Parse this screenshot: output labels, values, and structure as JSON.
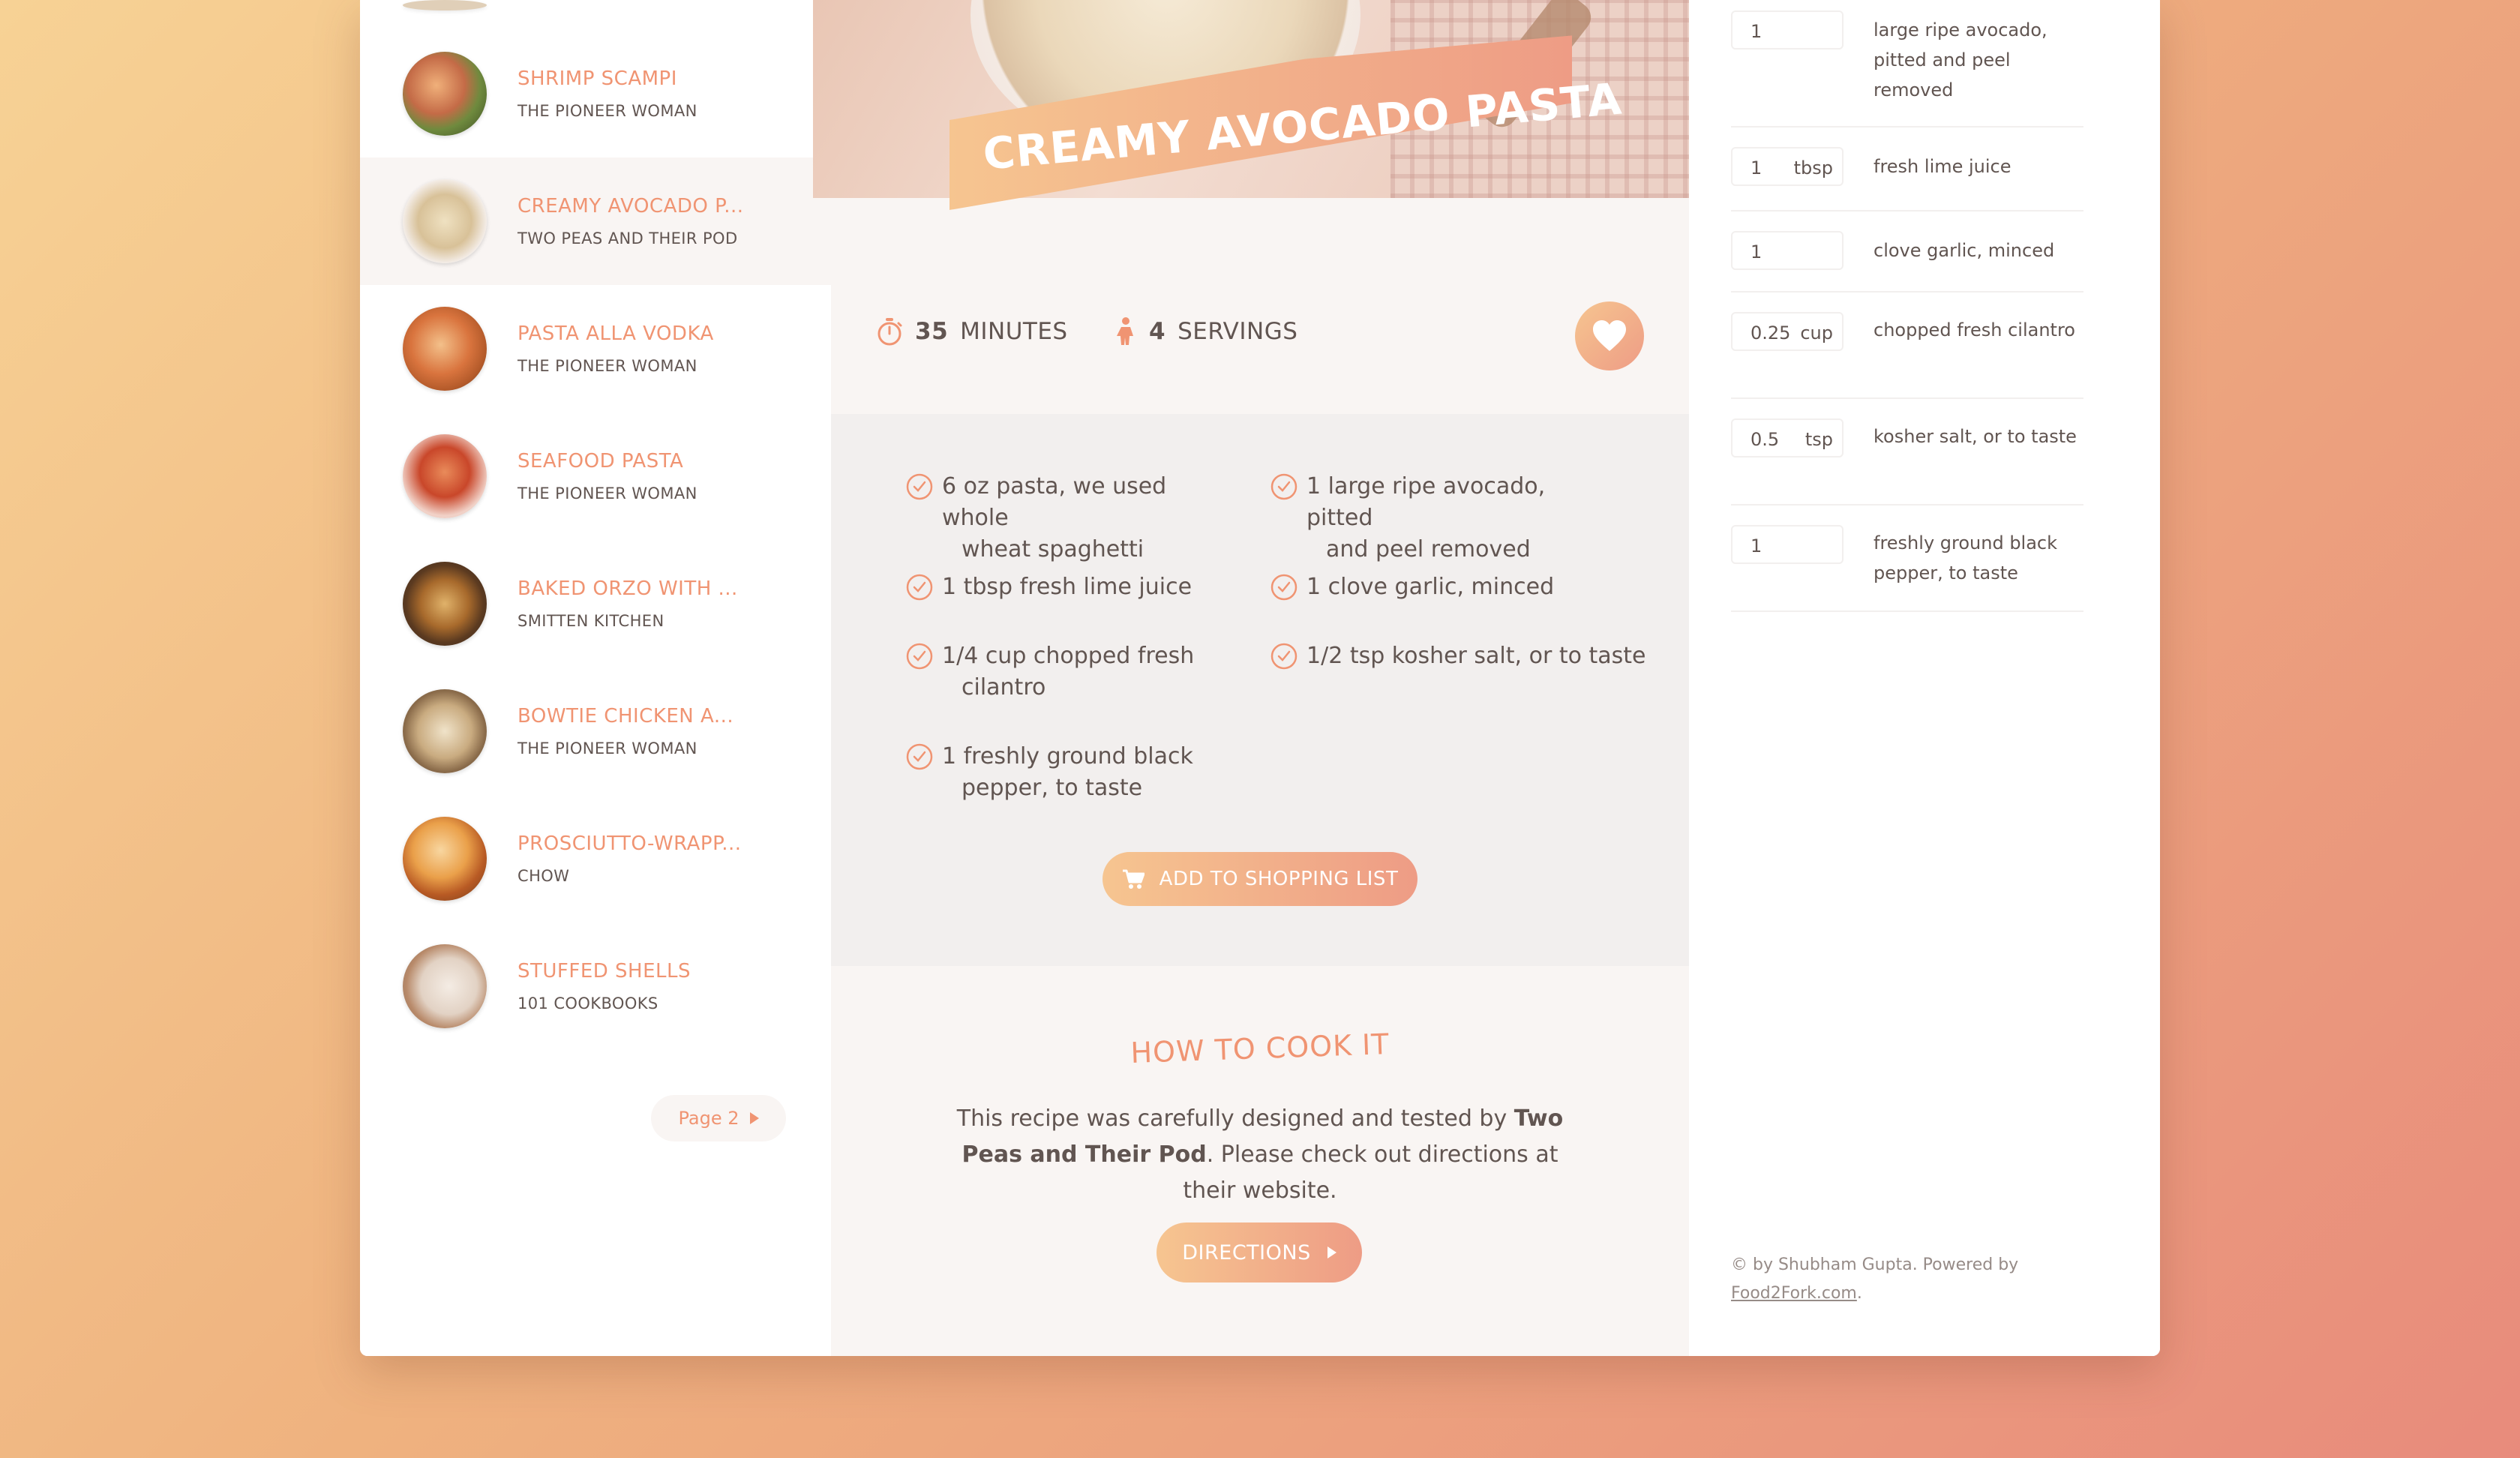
{
  "results": [
    {
      "title": "SHRIMP SCAMPI",
      "publisher": "THE PIONEER WOMAN",
      "active": false
    },
    {
      "title": "CREAMY AVOCADO P...",
      "publisher": "TWO PEAS AND THEIR POD",
      "active": true
    },
    {
      "title": "PASTA ALLA VODKA",
      "publisher": "THE PIONEER WOMAN",
      "active": false
    },
    {
      "title": "SEAFOOD PASTA",
      "publisher": "THE PIONEER WOMAN",
      "active": false
    },
    {
      "title": "BAKED ORZO WITH ...",
      "publisher": "SMITTEN KITCHEN",
      "active": false
    },
    {
      "title": "BOWTIE CHICKEN A...",
      "publisher": "THE PIONEER WOMAN",
      "active": false
    },
    {
      "title": "PROSCIUTTO-WRAPP...",
      "publisher": "CHOW",
      "active": false
    },
    {
      "title": "STUFFED SHELLS",
      "publisher": "101 COOKBOOKS",
      "active": false
    }
  ],
  "pagination": {
    "label": "Page 2"
  },
  "recipe": {
    "title": "CREAMY AVOCADO PASTA",
    "minutes_value": "35",
    "minutes_label": "MINUTES",
    "servings_value": "4",
    "servings_label": "SERVINGS",
    "ingredients": [
      {
        "first": "6 oz pasta, we used whole",
        "rest": "wheat spaghetti"
      },
      {
        "first": "1 large ripe avocado, pitted",
        "rest": "and peel removed"
      },
      {
        "first": "1 tbsp fresh lime juice",
        "rest": ""
      },
      {
        "first": "1 clove garlic, minced",
        "rest": ""
      },
      {
        "first": "1/4 cup chopped fresh",
        "rest": "cilantro"
      },
      {
        "first": "1/2 tsp kosher salt, or to taste",
        "rest": ""
      },
      {
        "first": "1 freshly ground black",
        "rest": "pepper, to taste"
      }
    ],
    "shopping_button": "ADD TO SHOPPING LIST",
    "directions_heading": "HOW TO COOK IT",
    "directions_text_1": "This recipe was carefully designed and tested by ",
    "directions_publisher": "Two Peas and Their Pod",
    "directions_text_2": ". Please check out directions at their website.",
    "directions_button": "DIRECTIONS"
  },
  "shopping_list": [
    {
      "count": "1",
      "unit": "",
      "ingredient": "large ripe avocado, pitted and peel removed"
    },
    {
      "count": "1",
      "unit": "tbsp",
      "ingredient": "fresh lime juice"
    },
    {
      "count": "1",
      "unit": "",
      "ingredient": "clove garlic, minced"
    },
    {
      "count": "0.25",
      "unit": "cup",
      "ingredient": "chopped fresh cilantro"
    },
    {
      "count": "0.5",
      "unit": "tsp",
      "ingredient": "kosher salt, or to taste"
    },
    {
      "count": "1",
      "unit": "",
      "ingredient": "freshly ground black pepper, to taste"
    }
  ],
  "footer": {
    "copyright": "© by Shubham Gupta. Powered by",
    "link": "Food2Fork.com",
    "suffix": "."
  },
  "icons": {
    "timer": "stopwatch-icon",
    "servings": "person-icon",
    "bookmark": "heart-icon",
    "check": "check-circle-icon",
    "cart": "cart-icon",
    "next": "triangle-right-icon"
  },
  "colors": {
    "accent": "#f09472",
    "gradient_start": "#f6c590",
    "gradient_end": "#ee9c85",
    "text": "#615551",
    "panel": "#f9f5f3",
    "panel_dark": "#f2efee"
  }
}
